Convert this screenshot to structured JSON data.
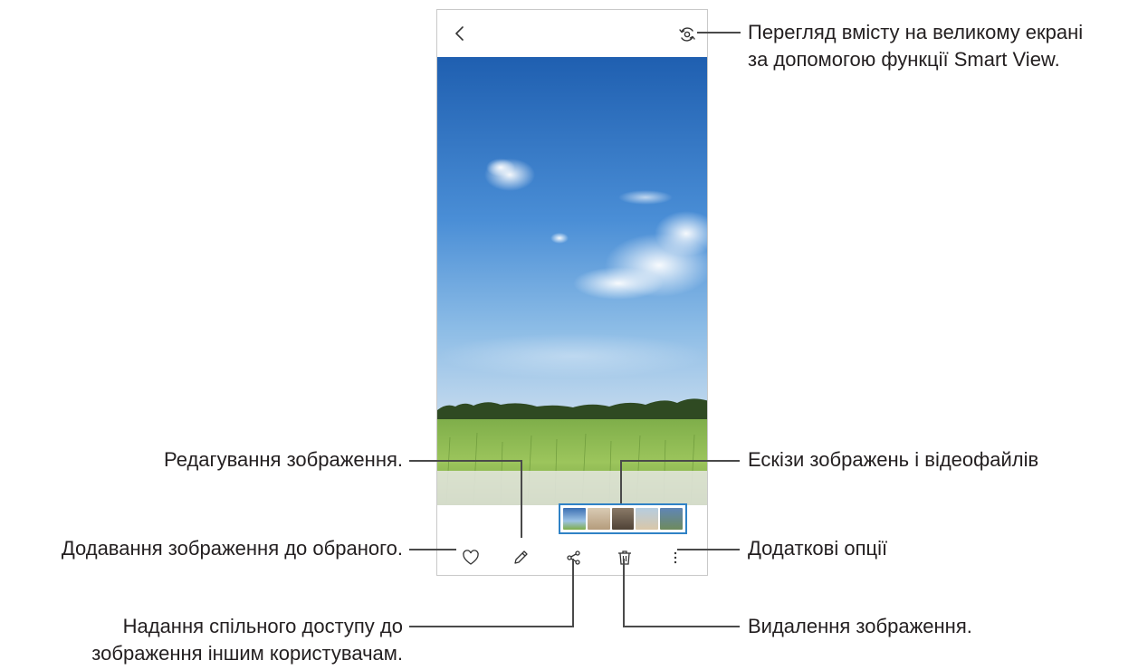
{
  "viewer": {
    "thumbnails": [
      "#5d86b8",
      "#c9b49a",
      "#6b5b4a",
      "#9fb5c8",
      "#6e8a5c"
    ],
    "accent": "#2f82c6",
    "icons": {
      "back": "chevron-left-icon",
      "cast": "smart-view-icon",
      "favorite": "heart-icon",
      "edit": "pencil-icon",
      "share": "share-icon",
      "delete": "trash-icon",
      "more": "more-vert-icon"
    }
  },
  "callouts": {
    "smart_view_line1": "Перегляд вмісту на великому екрані",
    "smart_view_line2": "за допомогою функції Smart View.",
    "edit": "Редагування зображення.",
    "thumbnails": "Ескізи зображень і відеофайлів",
    "favorite": "Додавання зображення до обраного.",
    "more": "Додаткові опції",
    "share_line1": "Надання спільного доступу до",
    "share_line2": "зображення іншим користувачам.",
    "delete": "Видалення зображення."
  }
}
